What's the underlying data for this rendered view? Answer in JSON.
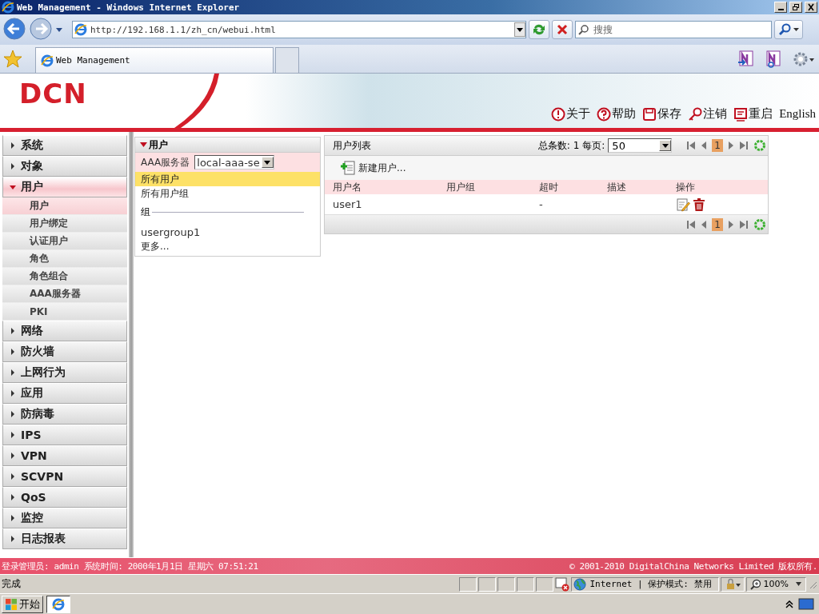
{
  "window": {
    "title": "Web Management - Windows Internet Explorer"
  },
  "browser": {
    "address": "http://192.168.1.1/zh_cn/webui.html",
    "search_placeholder": "搜搜",
    "tab_title": "Web Management"
  },
  "header": {
    "logo": "DCN",
    "links": [
      {
        "label": "关于",
        "kind": "about"
      },
      {
        "label": "帮助",
        "kind": "help"
      },
      {
        "label": "保存",
        "kind": "save"
      },
      {
        "label": "注销",
        "kind": "logout"
      },
      {
        "label": "重启",
        "kind": "restart"
      },
      {
        "label": "English",
        "kind": "language"
      }
    ]
  },
  "sidebar": {
    "items": [
      {
        "label": "系统",
        "expanded": false
      },
      {
        "label": "对象",
        "expanded": false
      },
      {
        "label": "用户",
        "expanded": true,
        "children": [
          {
            "label": "用户",
            "selected": true
          },
          {
            "label": "用户绑定",
            "selected": false
          },
          {
            "label": "认证用户",
            "selected": false
          },
          {
            "label": "角色",
            "selected": false
          },
          {
            "label": "角色组合",
            "selected": false
          },
          {
            "label": "AAA服务器",
            "selected": false
          },
          {
            "label": "PKI",
            "selected": false
          }
        ]
      },
      {
        "label": "网络",
        "expanded": false
      },
      {
        "label": "防火墙",
        "expanded": false
      },
      {
        "label": "上网行为",
        "expanded": false
      },
      {
        "label": "应用",
        "expanded": false
      },
      {
        "label": "防病毒",
        "expanded": false
      },
      {
        "label": "IPS",
        "expanded": false
      },
      {
        "label": "VPN",
        "expanded": false
      },
      {
        "label": "SCVPN",
        "expanded": false
      },
      {
        "label": "QoS",
        "expanded": false
      },
      {
        "label": "监控",
        "expanded": false
      },
      {
        "label": "日志报表",
        "expanded": false
      }
    ]
  },
  "user_panel": {
    "title": "用户",
    "aaa_label": "AAA服务器",
    "aaa_value": "local-aaa-se",
    "items": [
      {
        "label": "所有用户",
        "selected": true
      },
      {
        "label": "所有用户组",
        "selected": false
      }
    ],
    "group_heading": "组",
    "groups": [
      "usergroup1"
    ],
    "more": "更多..."
  },
  "user_list": {
    "title": "用户列表",
    "total": "总条数: 1",
    "per_page_label": "每页:",
    "per_page": "50",
    "page": "1",
    "new_button": "新建用户...",
    "columns": [
      "用户名",
      "用户组",
      "超时",
      "描述",
      "操作"
    ],
    "rows": [
      {
        "username": "user1",
        "timeout": "-"
      }
    ],
    "bottom_page": "1"
  },
  "footer": {
    "left": "登录管理员: admin 系统时间: 2000年1月1日 星期六 07:51:21",
    "right": "© 2001-2010 DigitalChina Networks Limited 版权所有."
  },
  "status_bar": {
    "text": "完成",
    "zone": "Internet | 保护模式: 禁用",
    "zoom": "100%"
  },
  "taskbar": {
    "start": "开始"
  }
}
